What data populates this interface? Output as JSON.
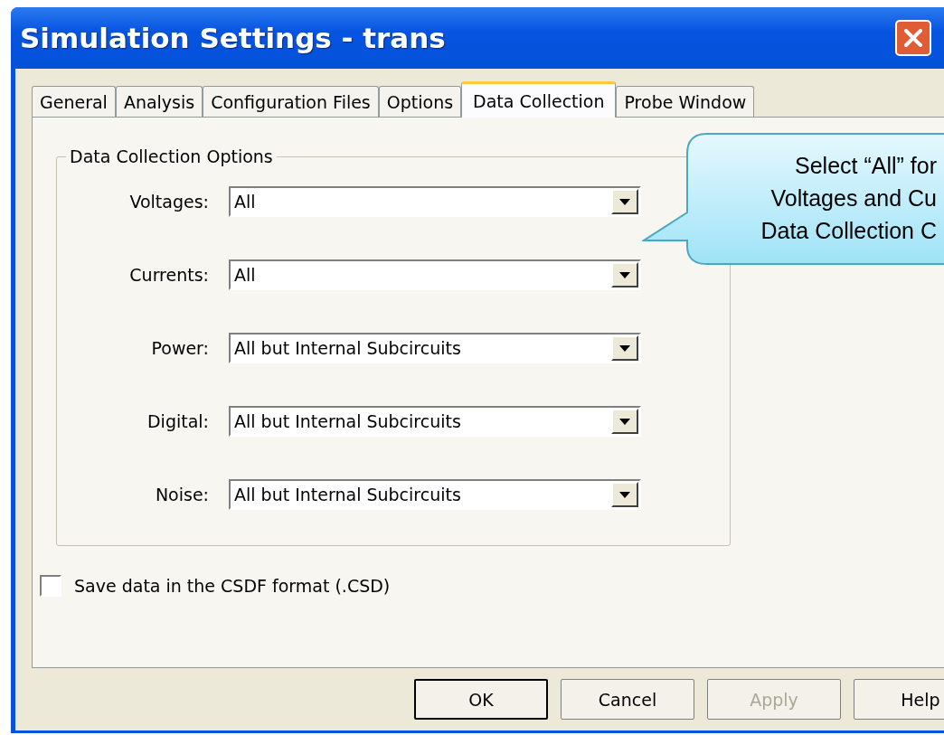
{
  "window": {
    "title": "Simulation Settings - trans"
  },
  "tabs": [
    {
      "label": "General",
      "selected": false
    },
    {
      "label": "Analysis",
      "selected": false
    },
    {
      "label": "Configuration Files",
      "selected": false
    },
    {
      "label": "Options",
      "selected": false
    },
    {
      "label": "Data Collection",
      "selected": true
    },
    {
      "label": "Probe Window",
      "selected": false
    }
  ],
  "group": {
    "title": "Data Collection Options",
    "fields": [
      {
        "label": "Voltages:",
        "value": "All"
      },
      {
        "label": "Currents:",
        "value": "All"
      },
      {
        "label": "Power:",
        "value": "All but Internal Subcircuits"
      },
      {
        "label": "Digital:",
        "value": "All but Internal Subcircuits"
      },
      {
        "label": "Noise:",
        "value": "All but Internal Subcircuits"
      }
    ]
  },
  "checkbox": {
    "label": "Save data in the CSDF format (.CSD)",
    "checked": false
  },
  "buttons": [
    {
      "label": "OK",
      "disabled": false,
      "default": true
    },
    {
      "label": "Cancel",
      "disabled": false,
      "default": false
    },
    {
      "label": "Apply",
      "disabled": true,
      "default": false
    },
    {
      "label": "Help",
      "disabled": false,
      "default": false
    }
  ],
  "callout": {
    "lines": [
      "Select “All” for",
      "Voltages and Cu",
      "Data Collection C"
    ]
  }
}
